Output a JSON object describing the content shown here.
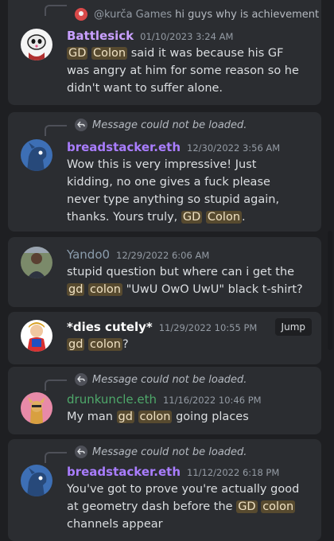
{
  "results": [
    {
      "reply": {
        "type": "mention",
        "mention": "@kurča Games",
        "text": "hi guys why is achievement for"
      },
      "username": "Battlesick",
      "username_color": "#c9a0ff",
      "timestamp": "01/10/2023 3:24 AM",
      "content": [
        {
          "t": "GD",
          "hl": true
        },
        {
          "t": " "
        },
        {
          "t": "Colon",
          "hl": true
        },
        {
          "t": " said it was because his GF was angry at him for some reason so he didn't want to suffer alone."
        }
      ]
    },
    {
      "reply": {
        "type": "failed",
        "text": "Message could not be loaded."
      },
      "username": "breadstacker.eth",
      "username_color": "#a97dff",
      "timestamp": "12/30/2022 3:56 AM",
      "content": [
        {
          "t": "Wow this is very impressive! Just kidding, no one gives a fuck please never type anything so stupid again, thanks. Yours truly, "
        },
        {
          "t": "GD",
          "hl": true
        },
        {
          "t": " "
        },
        {
          "t": "Colon",
          "hl": true
        },
        {
          "t": "."
        }
      ]
    },
    {
      "username": "Yando0",
      "username_color": "#8b9dad",
      "timestamp": "12/29/2022 6:06 AM",
      "content": [
        {
          "t": "stupid question but  where can i get the "
        },
        {
          "t": "gd",
          "hl": true
        },
        {
          "t": " "
        },
        {
          "t": "colon",
          "hl": true
        },
        {
          "t": " \"UwU OwO UwU\" black t-shirt?"
        }
      ]
    },
    {
      "username": "*dies cutely*",
      "username_color": "#ffffff",
      "timestamp": "11/29/2022 10:55 PM",
      "jump": "Jump",
      "content": [
        {
          "t": "gd",
          "hl": true
        },
        {
          "t": " "
        },
        {
          "t": "colon",
          "hl": true
        },
        {
          "t": "?"
        }
      ]
    },
    {
      "reply": {
        "type": "failed",
        "text": "Message could not be loaded."
      },
      "username": "drunkuncle.eth",
      "username_color": "#4ea86a",
      "timestamp": "11/16/2022 10:46 PM",
      "content": [
        {
          "t": "My man "
        },
        {
          "t": "gd",
          "hl": true
        },
        {
          "t": " "
        },
        {
          "t": "colon",
          "hl": true
        },
        {
          "t": " going places"
        }
      ]
    },
    {
      "reply": {
        "type": "failed",
        "text": "Message could not be loaded."
      },
      "username": "breadstacker.eth",
      "username_color": "#a97dff",
      "timestamp": "11/12/2022 6:18 PM",
      "content": [
        {
          "t": "You've got to prove you're actually good at geometry dash before the "
        },
        {
          "t": "GD",
          "hl": true
        },
        {
          "t": " "
        },
        {
          "t": "colon",
          "hl": true
        },
        {
          "t": " channels appear"
        }
      ]
    }
  ]
}
